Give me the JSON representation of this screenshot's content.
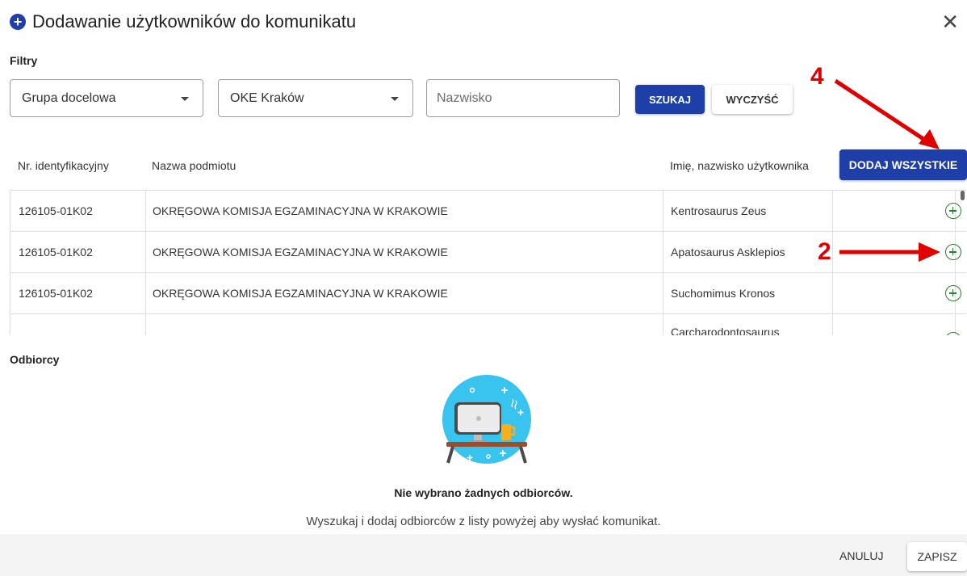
{
  "dialog": {
    "title": "Dodawanie użytkowników do komunikatu",
    "close_icon": "close-icon",
    "title_icon": "plus-circle-icon"
  },
  "filters": {
    "section_label": "Filtry",
    "target_group": "Grupa docelowa",
    "oke": "OKE Kraków",
    "surname_placeholder": "Nazwisko",
    "search_label": "SZUKAJ",
    "clear_label": "WYCZYŚĆ"
  },
  "table": {
    "headers": {
      "id": "Nr. identyfikacyjny",
      "entity": "Nazwa podmiotu",
      "user": "Imię, nazwisko użytkownika"
    },
    "add_all_label": "DODAJ WSZYSTKIE",
    "rows": [
      {
        "id": "126105-01K02",
        "entity": "OKRĘGOWA KOMISJA EGZAMINACYJNA W KRAKOWIE",
        "user": "Kentrosaurus Zeus"
      },
      {
        "id": "126105-01K02",
        "entity": "OKRĘGOWA KOMISJA EGZAMINACYJNA W KRAKOWIE",
        "user": "Apatosaurus Asklepios"
      },
      {
        "id": "126105-01K02",
        "entity": "OKRĘGOWA KOMISJA EGZAMINACYJNA W KRAKOWIE",
        "user": "Suchomimus Kronos"
      },
      {
        "id": "",
        "entity": "",
        "user": "Carcharodontosaurus"
      }
    ]
  },
  "recipients": {
    "section_label": "Odbiorcy",
    "empty_title": "Nie wybrano żadnych odbiorców.",
    "empty_subtitle": "Wyszukaj i dodaj odbiorców z listy powyżej aby wysłać komunikat."
  },
  "footer": {
    "cancel_label": "ANULUJ",
    "save_label": "ZAPISZ"
  },
  "annotations": {
    "label_add_all": "4",
    "label_add_row": "2",
    "color": "#e00000"
  },
  "colors": {
    "primary": "#1e3fa8",
    "add_icon": "#2e7d32"
  }
}
